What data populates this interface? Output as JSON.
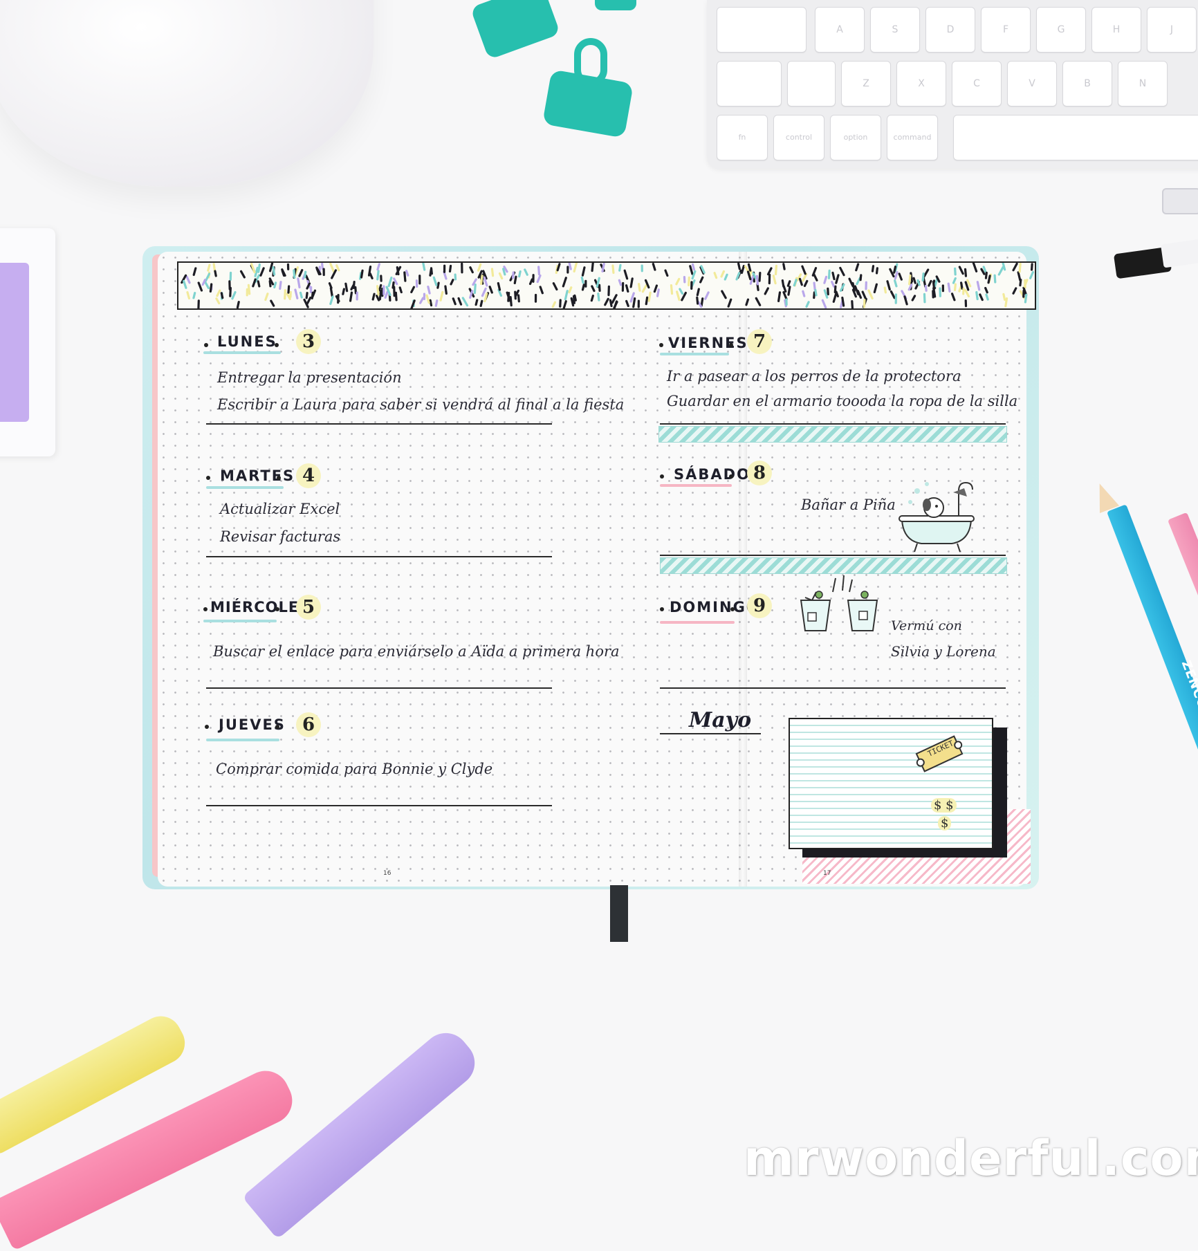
{
  "scene": {
    "background_color": "#f7f7f8",
    "accent_colors": {
      "mint": "#2ac0b0",
      "pink": "#f08aa6",
      "lilac": "#b5a3e6",
      "yellow": "#f1e08a",
      "blue": "#2db3dd"
    }
  },
  "keyboard": {
    "row1": [
      "A",
      "S",
      "D",
      "F",
      "G",
      "H",
      "J"
    ],
    "row2": [
      "Z",
      "X",
      "C",
      "V",
      "B",
      "N"
    ],
    "row3": [
      "fn",
      "control",
      "option",
      "command"
    ]
  },
  "left_page": {
    "days": [
      {
        "name": "LUNES",
        "number": "3",
        "notes": [
          "Entregar la presentación",
          "Escribir a Laura para saber si vendrá al final a la fiesta"
        ]
      },
      {
        "name": "MARTES",
        "number": "4",
        "notes": [
          "Actualizar Excel",
          "Revisar facturas"
        ]
      },
      {
        "name": "MIÉRCOLES",
        "number": "5",
        "notes": [
          "Buscar el enlace para enviárselo a Aïda a primera hora"
        ]
      },
      {
        "name": "JUEVES",
        "number": "6",
        "notes": [
          "Comprar comida para Bonnie y Clyde"
        ]
      }
    ],
    "page_number": "16"
  },
  "right_page": {
    "days": [
      {
        "name": "VIERNES",
        "number": "7",
        "notes": [
          "Ir a pasear a los perros de la protectora",
          "Guardar en el armario toooda la ropa de la silla"
        ]
      },
      {
        "name": "SÁBADO",
        "number": "8",
        "notes": [
          "Bañar a Piña"
        ]
      },
      {
        "name": "DOMINGO",
        "number": "9",
        "notes": [
          "Vermú con",
          "Silvia y Lorena"
        ]
      }
    ],
    "month_label": "Mayo",
    "ticket_text": "TICKET",
    "money_text_1": "$ $",
    "money_text_2": "$",
    "page_number": "17"
  },
  "pencil_brand": "ZENCOLOR",
  "watermark": "mrwonderful.com",
  "icons": [
    "bathtub-dog-icon",
    "cocktail-glasses-icon",
    "ticket-icon"
  ]
}
